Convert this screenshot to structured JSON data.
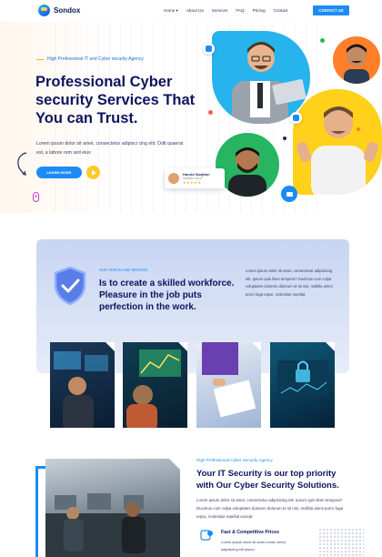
{
  "header": {
    "brand": "Sondox",
    "nav": [
      {
        "label": "Home ▾"
      },
      {
        "label": "About Us"
      },
      {
        "label": "Services"
      },
      {
        "label": "FAQ"
      },
      {
        "label": "Pricing"
      },
      {
        "label": "Contact"
      }
    ],
    "cta": "CONTACT US"
  },
  "hero": {
    "eyebrow": "High Professional IT and Cyber security Agency",
    "title": "Professional Cyber security Services That You can Trust.",
    "body": "Lorem ipsum dolor sit amet, consectetur adipisci cing elit. Odit quaerat est, a labore rem sed eius",
    "learn_more": "LEARN MORE",
    "review": {
      "name": "Harold Sanjiton",
      "role": "Satisfied client",
      "stars": "★★★★★"
    }
  },
  "mission": {
    "eyebrow": "OUR VISION AND MISSION",
    "title": "Is to create a skilled workforce. Pleasure in the job puts perfection in the work.",
    "body": "Lorem ipsum dolor sit amet, consectetur adipisicing elit. Ipsum quis illum tempora? Ducimus cum culpa voluptates dolorem dolorum et sit nisi, mollitia animi porro fuga eqsui, molestias repellat."
  },
  "security": {
    "eyebrow": "High Professional Cyber Security Agency",
    "title": "Your IT Security is our top priority with Our Cyber Security Solutions.",
    "body": "Lorem ipsum dolor sit amet, consectetur adipisicing elit. Ipsum quis illum tempora? Ducimus cum culpa voluptates dolorem dolorum et sit nisi, mollitia animi porro fuga eqsui, molestias repellat except.",
    "feature_title": "Fast & Competitive Prices",
    "feature_body": "Lorem ipsum dolor sit amet conse ctetur adipisicing elit ipsum."
  },
  "colors": {
    "primary": "#1d8bf5",
    "navy": "#0d1560",
    "yellow": "#ffc928",
    "band": "#c8d5f2"
  }
}
